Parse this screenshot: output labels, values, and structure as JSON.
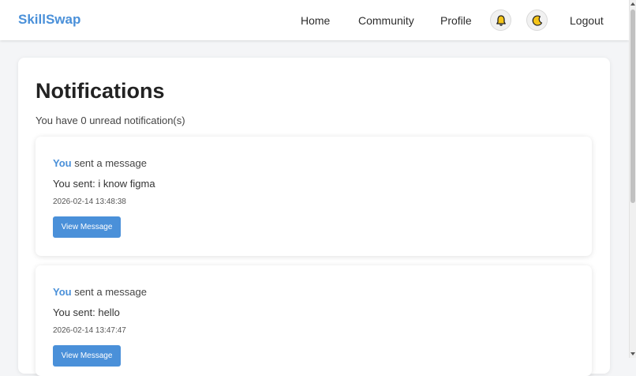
{
  "nav": {
    "brand": "SkillSwap",
    "links": [
      "Home",
      "Community",
      "Profile"
    ],
    "logout": "Logout",
    "notification_icon": "bell-icon",
    "theme_icon": "moon-icon"
  },
  "colors": {
    "accent": "#4a90d9",
    "background": "#f4f5f7"
  },
  "page": {
    "title": "Notifications",
    "unread_text": "You have 0 unread notification(s)"
  },
  "notifications": [
    {
      "actor": "You",
      "action": " sent a message",
      "message": "You sent: i know figma",
      "timestamp": "2026-02-14 13:48:38",
      "button": "View Message"
    },
    {
      "actor": "You",
      "action": " sent a message",
      "message": "You sent: hello",
      "timestamp": "2026-02-14 13:47:47",
      "button": "View Message"
    }
  ]
}
